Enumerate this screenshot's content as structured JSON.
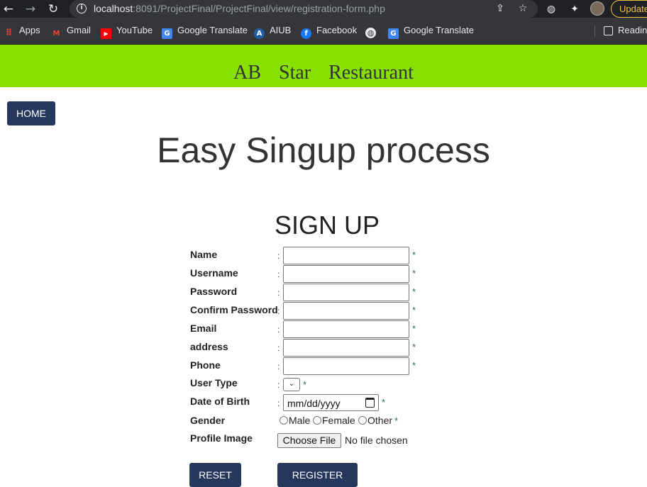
{
  "browser": {
    "back_icon": "back-arrow-icon",
    "forward_icon": "forward-arrow-icon",
    "reload_icon": "reload-icon",
    "url_host": "localhost",
    "url_rest": ":8091/ProjectFinal/ProjectFinal/view/registration-form.php",
    "update_label": "Update",
    "reading_list_label": "Reading"
  },
  "bookmarks": [
    {
      "label": "Apps",
      "icon": "apps-grid-icon"
    },
    {
      "label": "Gmail",
      "icon": "gmail-icon"
    },
    {
      "label": "YouTube",
      "icon": "youtube-icon"
    },
    {
      "label": "Google Translate",
      "icon": "google-translate-icon"
    },
    {
      "label": "AIUB",
      "icon": "aiub-icon"
    },
    {
      "label": "Facebook",
      "icon": "facebook-icon"
    },
    {
      "label": "",
      "icon": "globe-icon"
    },
    {
      "label": "Google Translate",
      "icon": "google-translate-icon"
    }
  ],
  "site": {
    "title": "AB Star Restaurant",
    "header_color": "#88e000",
    "button_color": "#26375e"
  },
  "nav": {
    "home_label": "HOME"
  },
  "page": {
    "heading": "Easy Singup process",
    "form_title": "SIGN UP"
  },
  "form": {
    "fields": [
      {
        "label": "Name",
        "value": "",
        "required": "*"
      },
      {
        "label": "Username",
        "value": "",
        "required": "*"
      },
      {
        "label": "Password",
        "value": "",
        "required": "*"
      },
      {
        "label": "Confirm Password",
        "value": "",
        "required": "*"
      },
      {
        "label": "Email",
        "value": "",
        "required": "*"
      },
      {
        "label": "address",
        "value": "",
        "required": "*"
      },
      {
        "label": "Phone",
        "value": "",
        "required": "*"
      }
    ],
    "colon": ":",
    "user_type": {
      "label": "User Type",
      "selected": "",
      "required": "*"
    },
    "dob": {
      "label": "Date of Birth",
      "placeholder": "mm/dd/yyyy",
      "required": "*"
    },
    "gender": {
      "label": "Gender",
      "options": [
        "Male",
        "Female",
        "Other"
      ],
      "required": "*"
    },
    "profile_image": {
      "label": "Profile Image",
      "button_label": "Choose File",
      "status": "No file chosen"
    },
    "reset_label": "RESET",
    "register_label": "REGISTER"
  }
}
